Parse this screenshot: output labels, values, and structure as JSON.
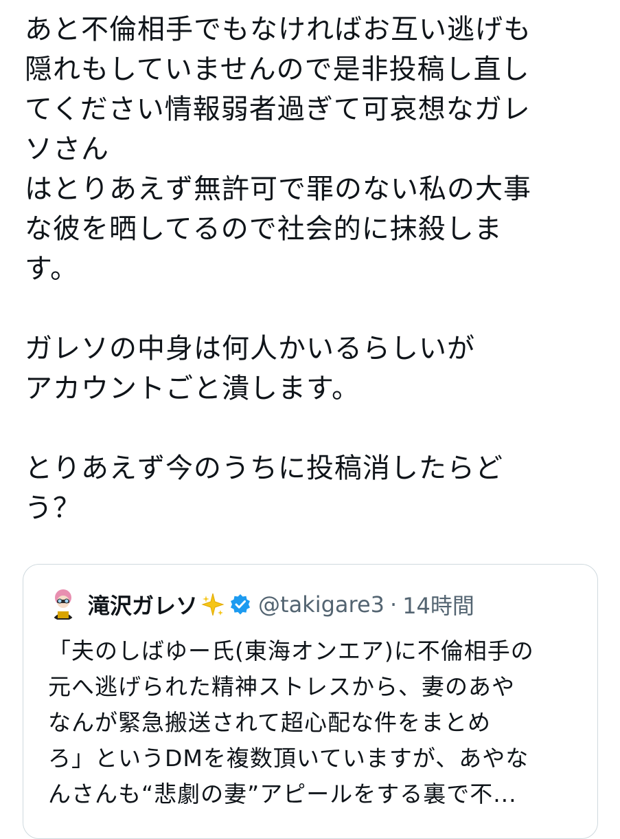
{
  "tweet": {
    "lines": [
      "あと不倫相手でもなければお互い逃げも",
      "隠れもしていませんので是非投稿し直し",
      "てください情報弱者過ぎて可哀想なガレ",
      "ソさん",
      "はとりあえず無許可で罪のない私の大事",
      "な彼を晒してるので社会的に抹殺しま",
      "す。",
      "",
      "ガレソの中身は何人かいるらしいが",
      "アカウントごと潰します。",
      "",
      "とりあえず今のうちに投稿消したらど",
      "う？"
    ]
  },
  "quote": {
    "author_name": "滝沢ガレソ",
    "handle": "@takigare3",
    "separator": "·",
    "time_ago": "14時間",
    "lines": [
      "「夫のしばゆー氏(東海オンエア)に不倫相手の",
      "元へ逃げられた精神ストレスから、妻のあや",
      "なんが緊急搬送されて超心配な件をまとめ",
      "ろ」というDMを複数頂いていますが、あやな",
      "んさんも“悲劇の妻”アピールをする裏で不..."
    ],
    "icons": {
      "avatar": "avatar-image",
      "badge": "sparkle-icon",
      "verified": "verified-badge-icon"
    },
    "colors": {
      "verified": "#1d9bf0",
      "sparkle": "#f5c518",
      "border": "#cfd9de",
      "secondary_text": "#536471"
    }
  }
}
